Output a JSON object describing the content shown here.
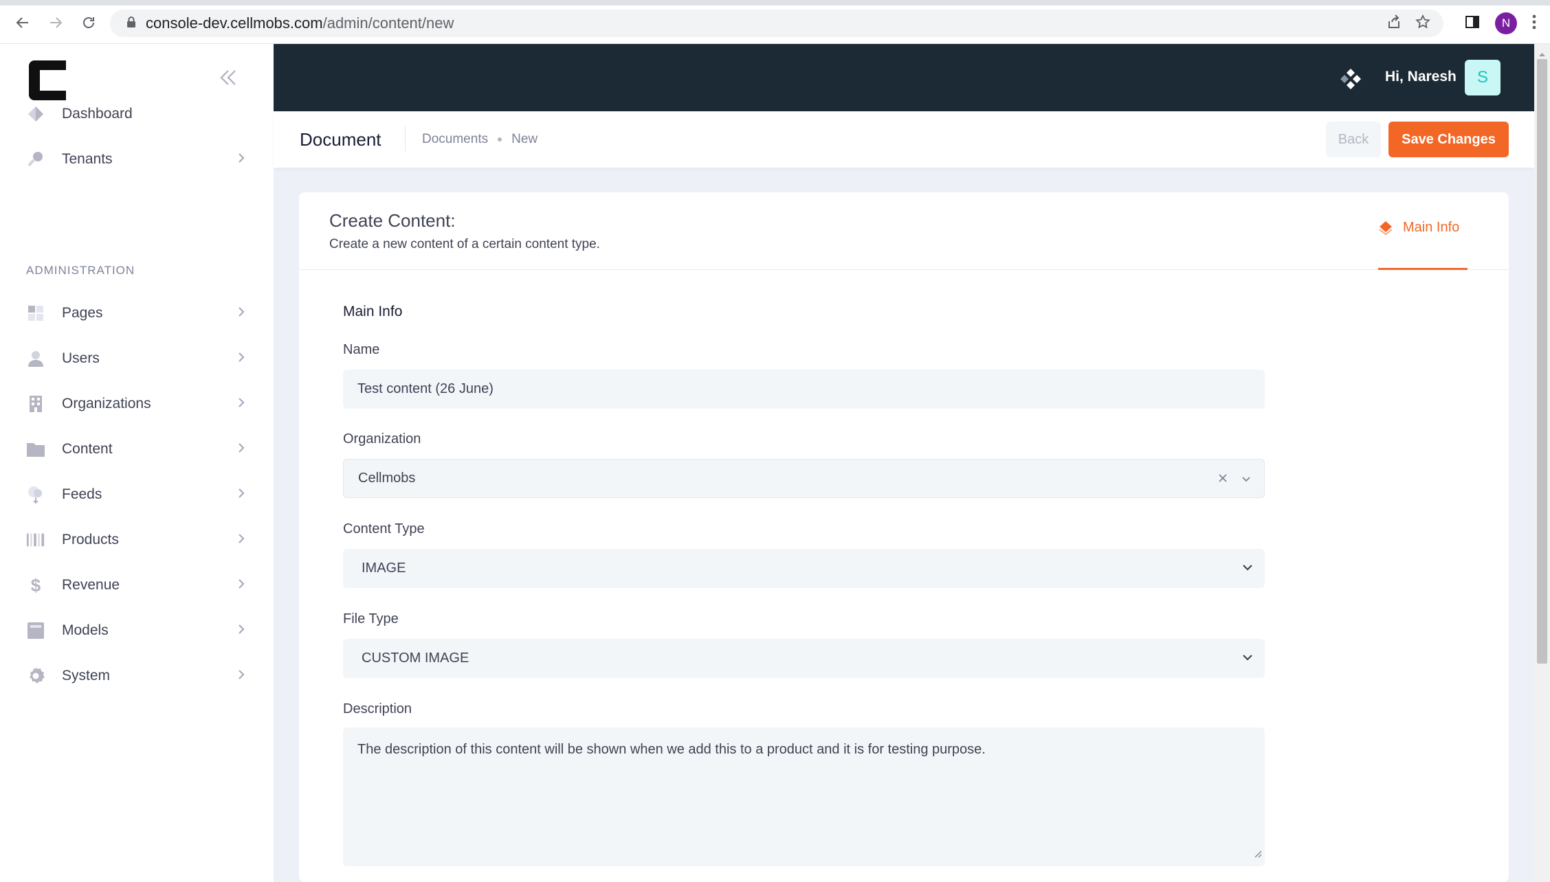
{
  "browser": {
    "url_host": "console-dev.cellmobs.com",
    "url_path": "/admin/content/new",
    "profile_initial": "N"
  },
  "sidebar": {
    "section_title": "ADMINISTRATION",
    "top_items": [
      {
        "label": "Dashboard",
        "icon": "dashboard-icon",
        "has_arrow": false
      },
      {
        "label": "Tenants",
        "icon": "tenants-icon",
        "has_arrow": true
      }
    ],
    "admin_items": [
      {
        "label": "Pages",
        "icon": "pages-icon"
      },
      {
        "label": "Users",
        "icon": "users-icon"
      },
      {
        "label": "Organizations",
        "icon": "organizations-icon"
      },
      {
        "label": "Content",
        "icon": "folder-icon"
      },
      {
        "label": "Feeds",
        "icon": "feeds-icon"
      },
      {
        "label": "Products",
        "icon": "barcode-icon"
      },
      {
        "label": "Revenue",
        "icon": "dollar-icon"
      },
      {
        "label": "Models",
        "icon": "models-icon"
      },
      {
        "label": "System",
        "icon": "gear-icon"
      }
    ]
  },
  "header": {
    "greeting": "Hi, Naresh",
    "avatar_initial": "S"
  },
  "subheader": {
    "title": "Document",
    "breadcrumb_1": "Documents",
    "breadcrumb_2": "New",
    "back_label": "Back",
    "save_label": "Save Changes"
  },
  "card": {
    "title": "Create Content:",
    "subtitle": "Create a new content of a certain content type.",
    "tab_label": "Main Info",
    "section_title": "Main Info"
  },
  "form": {
    "name_label": "Name",
    "name_value": "Test content (26 June)",
    "organization_label": "Organization",
    "organization_value": "Cellmobs",
    "content_type_label": "Content Type",
    "content_type_value": "IMAGE",
    "file_type_label": "File Type",
    "file_type_value": "CUSTOM IMAGE",
    "description_label": "Description",
    "description_value": "The description of this content will be shown when we add this to a product and it is for testing purpose."
  },
  "colors": {
    "accent": "#f26726",
    "header_bg": "#1b2a35",
    "avatar_bg": "#c9f7f5",
    "avatar_fg": "#1bc5bd"
  }
}
